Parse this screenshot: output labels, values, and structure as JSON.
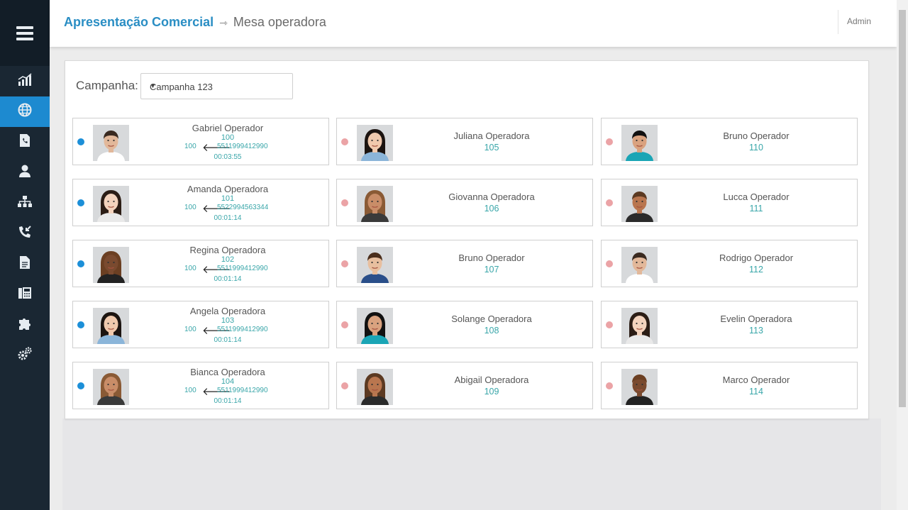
{
  "header": {
    "title": "Apresentação Comercial",
    "separator": "⇾",
    "subtitle": "Mesa operadora",
    "user": "Admin"
  },
  "sidebar": {
    "items": [
      {
        "icon": "bar-chart-icon",
        "active": false
      },
      {
        "icon": "globe-icon",
        "active": true
      },
      {
        "icon": "phone-document-icon",
        "active": false
      },
      {
        "icon": "user-icon",
        "active": false
      },
      {
        "icon": "sitemap-icon",
        "active": false
      },
      {
        "icon": "incoming-call-icon",
        "active": false
      },
      {
        "icon": "document-icon",
        "active": false
      },
      {
        "icon": "fax-icon",
        "active": false
      },
      {
        "icon": "puzzle-icon",
        "active": false
      },
      {
        "icon": "gears-icon",
        "active": false
      }
    ]
  },
  "campaign": {
    "label": "Campanha:",
    "selected": "Campanha 123",
    "caret": "▼"
  },
  "colors": {
    "accent": "#1d8ad0",
    "busy": "#1c8fd8",
    "free": "#eba3a6",
    "extension": "#39a6a9"
  },
  "operators": [
    {
      "name": "Gabriel Operador",
      "ext": "100",
      "status": "busy",
      "call": {
        "from": "100",
        "arrow": "🡐",
        "to": "5511999412990",
        "duration": "00:03:55"
      }
    },
    {
      "name": "Juliana Operadora",
      "ext": "105",
      "status": "free"
    },
    {
      "name": "Bruno Operador",
      "ext": "110",
      "status": "free"
    },
    {
      "name": "Amanda Operadora",
      "ext": "101",
      "status": "busy",
      "call": {
        "from": "100",
        "arrow": "🡐",
        "to": "5522994563344",
        "duration": "00:01:14"
      }
    },
    {
      "name": "Giovanna Operadora",
      "ext": "106",
      "status": "free"
    },
    {
      "name": "Lucca Operador",
      "ext": "111",
      "status": "free"
    },
    {
      "name": "Regina Operadora",
      "ext": "102",
      "status": "busy",
      "call": {
        "from": "100",
        "arrow": "🡐",
        "to": "5511999412990",
        "duration": "00:01:14"
      }
    },
    {
      "name": "Bruno Operador",
      "ext": "107",
      "status": "free"
    },
    {
      "name": "Rodrigo Operador",
      "ext": "112",
      "status": "free"
    },
    {
      "name": "Angela Operadora",
      "ext": "103",
      "status": "busy",
      "call": {
        "from": "100",
        "arrow": "🡐",
        "to": "5511999412990",
        "duration": "00:01:14"
      }
    },
    {
      "name": "Solange Operadora",
      "ext": "108",
      "status": "free"
    },
    {
      "name": "Evelin Operadora",
      "ext": "113",
      "status": "free"
    },
    {
      "name": "Bianca Operadora",
      "ext": "104",
      "status": "busy",
      "call": {
        "from": "100",
        "arrow": "🡐",
        "to": "5511999412990",
        "duration": "00:01:14"
      }
    },
    {
      "name": "Abigail Operadora",
      "ext": "109",
      "status": "free"
    },
    {
      "name": "Marco Operador",
      "ext": "114",
      "status": "free"
    }
  ]
}
